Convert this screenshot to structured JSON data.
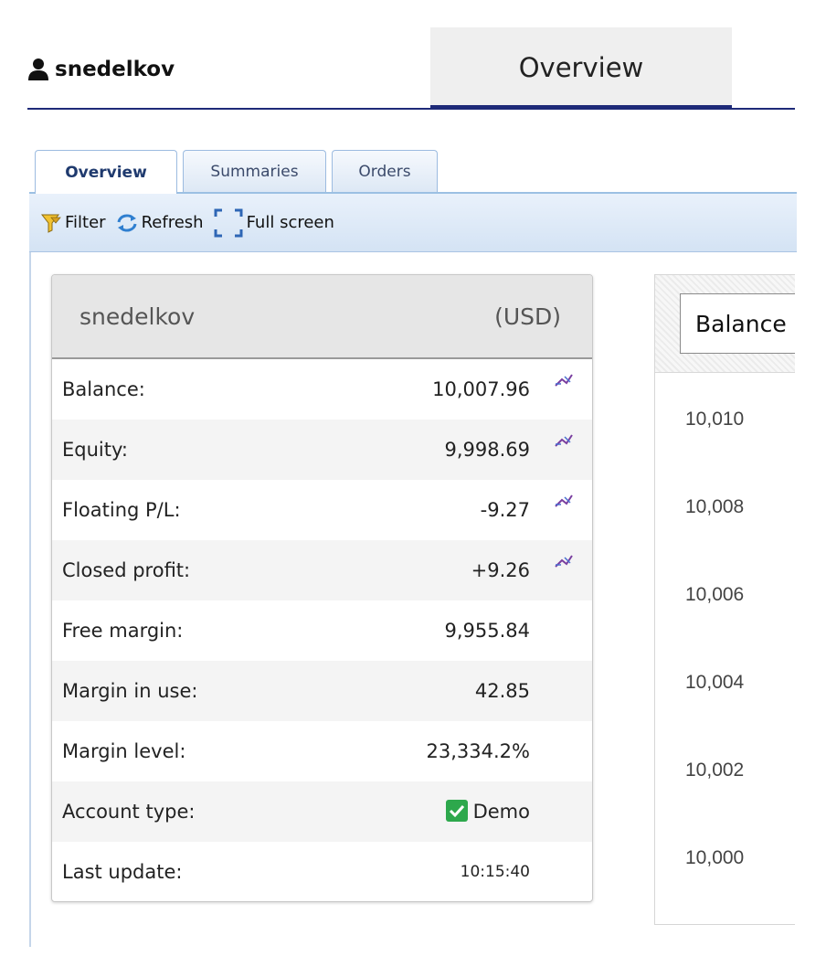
{
  "header": {
    "user_name": "snedelkov",
    "main_tab": "Overview"
  },
  "inner_tabs": [
    {
      "label": "Overview",
      "active": true
    },
    {
      "label": "Summaries",
      "active": false
    },
    {
      "label": "Orders",
      "active": false
    }
  ],
  "toolbar": {
    "filter_label": "Filter",
    "refresh_label": "Refresh",
    "fullscreen_label": "Full screen"
  },
  "account": {
    "name": "snedelkov",
    "currency": "(USD)",
    "rows": [
      {
        "label": "Balance:",
        "value": "10,007.96",
        "chart_icon": true
      },
      {
        "label": "Equity:",
        "value": "9,998.69",
        "chart_icon": true
      },
      {
        "label": "Floating P/L:",
        "value": "-9.27",
        "chart_icon": true
      },
      {
        "label": "Closed profit:",
        "value": "+9.26",
        "chart_icon": true
      },
      {
        "label": "Free margin:",
        "value": "9,955.84",
        "chart_icon": false
      },
      {
        "label": "Margin in use:",
        "value": "42.85",
        "chart_icon": false
      },
      {
        "label": "Margin level:",
        "value": "23,334.2%",
        "chart_icon": false
      },
      {
        "label": "Account type:",
        "value": "Demo",
        "chart_icon": false,
        "checked": true
      },
      {
        "label": "Last update:",
        "value": "10:15:40",
        "chart_icon": false
      }
    ]
  },
  "chart_panel": {
    "selector_value": "Balance"
  },
  "chart_data": {
    "type": "line",
    "title": "",
    "ylim": [
      9999,
      10011
    ],
    "y_ticks": [
      "10,010",
      "10,008",
      "10,006",
      "10,004",
      "10,002",
      "10,000"
    ],
    "series": []
  },
  "colors": {
    "accent_navy": "#1e2a78",
    "tab_border": "#9cbbe0",
    "check_green": "#2da84c",
    "chart_icon": "#7a3fa0"
  }
}
